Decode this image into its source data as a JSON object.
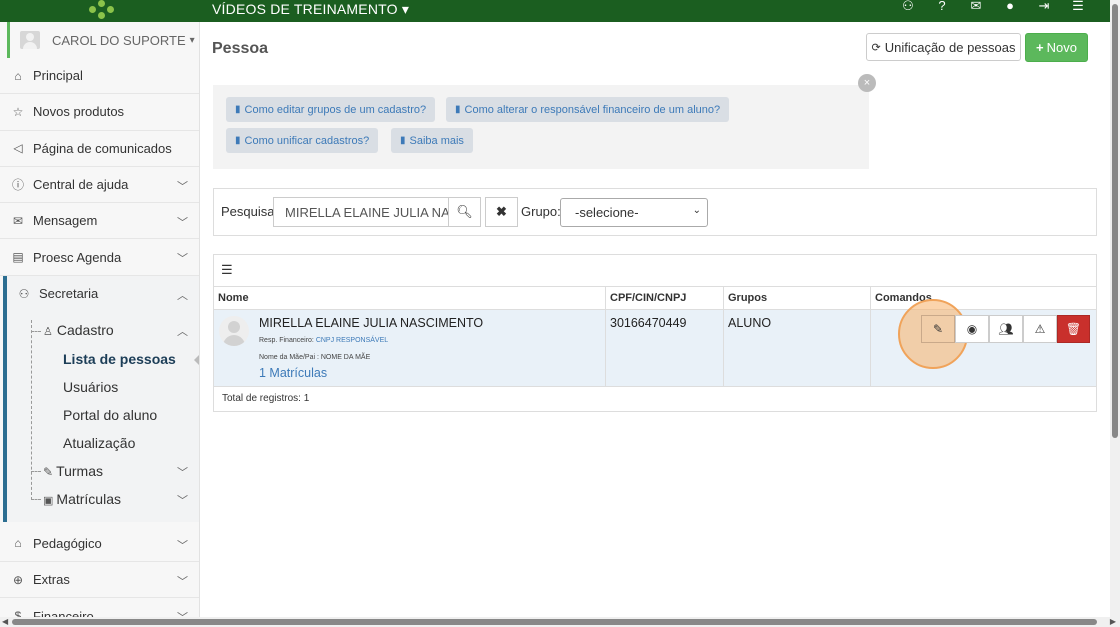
{
  "topbar": {
    "title": "VÍDEOS DE TREINAMENTO",
    "title_caret": "▾",
    "icons": [
      "handshake-icon",
      "help-icon",
      "mail-icon",
      "user-icon",
      "logout-icon",
      "hamburger-icon"
    ]
  },
  "sidebar": {
    "user_name": "CAROL DO SUPORTE",
    "user_caret": "▾",
    "items": [
      {
        "label": "Principal",
        "icon": "⌂"
      },
      {
        "label": "Novos produtos",
        "icon": "☆"
      },
      {
        "label": "Página de comunicados",
        "icon": "📢"
      },
      {
        "label": "Central de ajuda",
        "icon": "ⓘ"
      },
      {
        "label": "Mensagem",
        "icon": "✉"
      },
      {
        "label": "Proesc Agenda",
        "icon": "▤"
      },
      {
        "label": "Secretaria",
        "icon": "👥"
      },
      {
        "label": "Pedagógico",
        "icon": "🎓"
      },
      {
        "label": "Extras",
        "icon": "⊕"
      },
      {
        "label": "Financeiro",
        "icon": "$"
      }
    ],
    "secretaria": {
      "cadastro": "Cadastro",
      "lista": "Lista de pessoas",
      "usuarios": "Usuários",
      "portal": "Portal do aluno",
      "atualizacao": "Atualização",
      "turmas": "Turmas",
      "matriculas": "Matrículas"
    }
  },
  "page": {
    "title": "Pessoa",
    "unificacao_button": "Unificação de pessoas",
    "novo_button": "Novo"
  },
  "help": {
    "close": "×",
    "links": [
      "Como editar grupos de um cadastro?",
      "Como alterar o responsável financeiro de um aluno?",
      "Como unificar cadastros?",
      "Saiba mais"
    ]
  },
  "search": {
    "label": "Pesquisa",
    "value": "MIRELLA ELAINE JULIA NAS",
    "group_label": "Grupo:",
    "group_value": "-selecione-"
  },
  "table": {
    "headers": [
      "Nome",
      "CPF/CIN/CNPJ",
      "Grupos",
      "Comandos"
    ],
    "rows": [
      {
        "name": "MIRELLA ELAINE JULIA NASCIMENTO",
        "resp_label": "Resp. Financeiro:",
        "resp_value": "CNPJ RESPONSÁVEL",
        "mae_label": "Nome da Mãe/Pai : NOME DA MÃE",
        "matriculas": "1 Matrículas",
        "cpf": "30166470449",
        "grupos": "ALUNO"
      }
    ],
    "total": "Total de registros: 1"
  },
  "colors": {
    "topbar": "#1b5e20",
    "novo": "#5cb85c",
    "delete": "#c9302c",
    "link": "#3d7ab8",
    "highlight": "#f7b068"
  }
}
